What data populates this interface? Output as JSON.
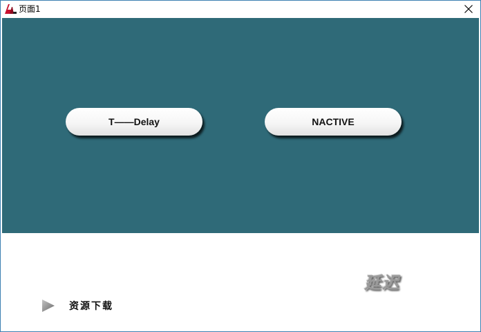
{
  "window": {
    "title": "页面1"
  },
  "buttons": {
    "delay_label": "T——Delay",
    "nactive_label": "NACTIVE"
  },
  "footer": {
    "download_label": "资源下载",
    "brush_text": "延迟"
  },
  "colors": {
    "stage_background": "#2f6a78",
    "window_border": "#3c7fb1",
    "button_face": "#ffffff"
  },
  "icons": {
    "app": "app-logo-icon",
    "close": "close-icon",
    "play": "play-arrow-icon"
  }
}
